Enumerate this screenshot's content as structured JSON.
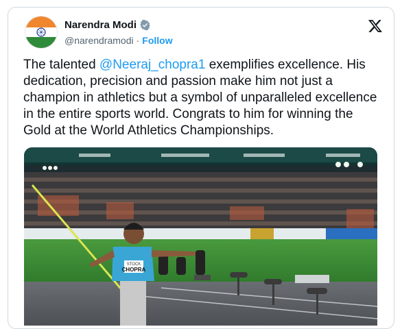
{
  "author": {
    "display_name": "Narendra Modi",
    "handle": "@narendramodi",
    "separator": "·",
    "follow_label": "Follow",
    "verified": true
  },
  "tweet": {
    "text_before": "The talented ",
    "mention": "@Neeraj_chopra1",
    "text_after": " exemplifies excellence. His dedication, precision and passion make him not just a champion in athletics but a symbol of unparalleled excellence in the entire sports world. Congrats to him for winning the Gold at the World Athletics Championships."
  },
  "media": {
    "bib_name": "CHOPRA",
    "bib_team": "STOCK"
  },
  "colors": {
    "link": "#1d9bf0",
    "text": "#0f1419",
    "muted": "#536471",
    "verified": "#829aab"
  },
  "icons": [
    "x-logo-icon",
    "verified-badge-icon"
  ]
}
